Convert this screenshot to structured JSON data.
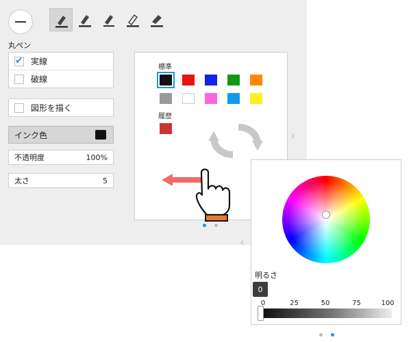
{
  "pen": {
    "section_label": "丸ペン",
    "tools": [
      "pen-round-icon",
      "pen-chisel-icon",
      "pen-brush-icon",
      "pen-fountain-icon",
      "highlighter-icon"
    ]
  },
  "line_style": {
    "options": [
      {
        "label": "実線",
        "checked": true
      },
      {
        "label": "破線",
        "checked": false
      }
    ]
  },
  "draw_shape": {
    "label": "図形を描く",
    "checked": false
  },
  "ink_color": {
    "label": "インク色",
    "value": "#111111"
  },
  "opacity": {
    "label": "不透明度",
    "value": "100%"
  },
  "thickness": {
    "label": "太さ",
    "value": "5"
  },
  "palette": {
    "standard_title": "標準",
    "standard_colors": [
      "#111111",
      "#ee1111",
      "#1122ee",
      "#119911",
      "#ff8800",
      "#999999",
      "#ffffff",
      "#ff66dd",
      "#1199ee",
      "#ffee22"
    ],
    "history_title": "履歴",
    "history_colors": [
      "#cc3333"
    ]
  },
  "brightness": {
    "label": "明るさ",
    "value": "0",
    "ticks": [
      "0",
      "25",
      "50",
      "75",
      "100"
    ]
  },
  "colors": {
    "accent": "#1a9ad6",
    "arrow": "#f06a6a"
  }
}
